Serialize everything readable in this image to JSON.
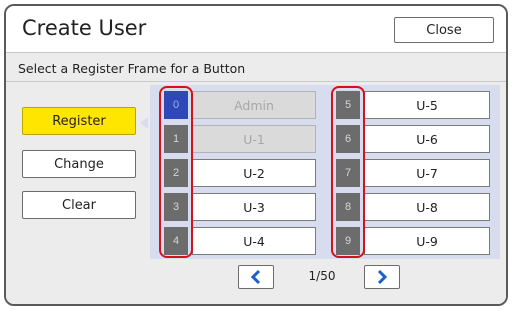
{
  "window": {
    "title": "Create User",
    "close_label": "Close"
  },
  "subtitle": "Select a Register Frame for a Button",
  "actions": [
    {
      "label": "Register",
      "active": true
    },
    {
      "label": "Change",
      "active": false
    },
    {
      "label": "Clear",
      "active": false
    }
  ],
  "frames": [
    {
      "number": "0",
      "name": "Admin",
      "disabled": true,
      "selected": true
    },
    {
      "number": "1",
      "name": "U-1",
      "disabled": true,
      "selected": false
    },
    {
      "number": "2",
      "name": "U-2",
      "disabled": false,
      "selected": false
    },
    {
      "number": "3",
      "name": "U-3",
      "disabled": false,
      "selected": false
    },
    {
      "number": "4",
      "name": "U-4",
      "disabled": false,
      "selected": false
    },
    {
      "number": "5",
      "name": "U-5",
      "disabled": false,
      "selected": false
    },
    {
      "number": "6",
      "name": "U-6",
      "disabled": false,
      "selected": false
    },
    {
      "number": "7",
      "name": "U-7",
      "disabled": false,
      "selected": false
    },
    {
      "number": "8",
      "name": "U-8",
      "disabled": false,
      "selected": false
    },
    {
      "number": "9",
      "name": "U-9",
      "disabled": false,
      "selected": false
    }
  ],
  "pagination": {
    "current": "1/50",
    "prev_icon": "chevron-left-icon",
    "next_icon": "chevron-right-icon"
  },
  "colors": {
    "accent_yellow": "#ffe600",
    "highlight_red": "#d4121c",
    "selected_blue": "#2e48b8",
    "nav_blue": "#1f5fc8"
  }
}
